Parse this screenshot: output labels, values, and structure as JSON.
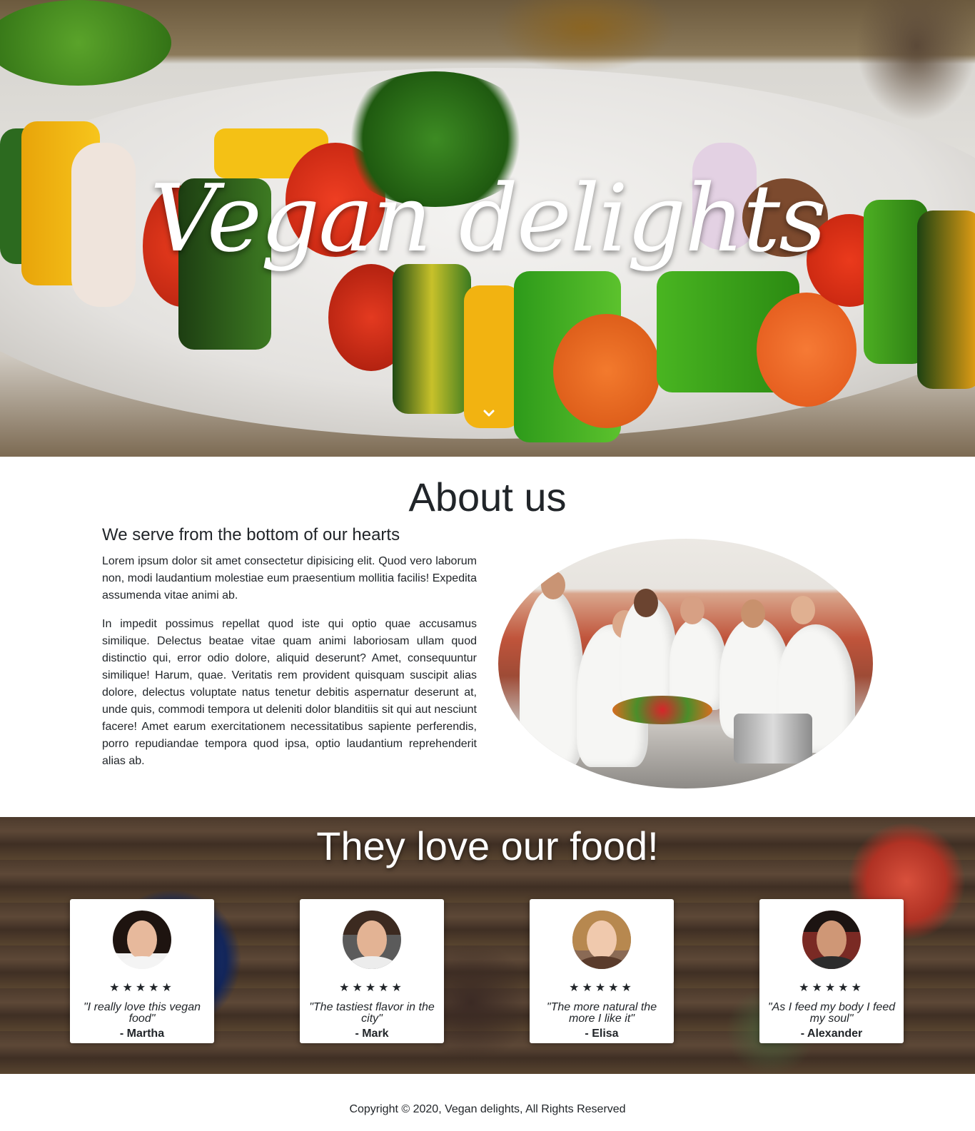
{
  "hero": {
    "title": "Vegan delights",
    "scroll_icon": "chevron-down-icon"
  },
  "about": {
    "heading": "About us",
    "subheading": "We serve from the bottom of our hearts",
    "paragraphs": [
      "Lorem ipsum dolor sit amet consectetur dipisicing elit. Quod vero laborum non, modi laudantium molestiae eum praesentium mollitia facilis! Expedita assumenda vitae animi ab.",
      "In impedit possimus repellat quod iste qui optio quae accusamus similique. Delectus beatae vitae quam animi laboriosam ullam quod distinctio qui, error odio dolore, aliquid deserunt? Amet, consequuntur similique! Harum, quae. Veritatis rem provident quisquam suscipit alias dolore, delectus voluptate natus tenetur debitis aspernatur deserunt at, unde quis, commodi tempora ut deleniti dolor blanditiis sit qui aut nesciunt facere! Amet earum exercitationem necessitatibus sapiente perferendis, porro repudiandae tempora quod ipsa, optio laudantium reprehenderit alias ab."
    ]
  },
  "testimonials": {
    "heading": "They love our food!",
    "items": [
      {
        "stars": "★★★★★",
        "rating": 5,
        "quote": "\"I really love this vegan food\"",
        "author": "- Martha"
      },
      {
        "stars": "★★★★★",
        "rating": 5,
        "quote": "\"The tastiest flavor in the city\"",
        "author": "- Mark"
      },
      {
        "stars": "★★★★★",
        "rating": 5,
        "quote": "\"The more natural the more I like it\"",
        "author": "- Elisa"
      },
      {
        "stars": "★★★★★",
        "rating": 5,
        "quote": "\"As I feed my body I feed my soul\"",
        "author": "- Alexander"
      }
    ]
  },
  "footer": {
    "copyright": "Copyright © 2020, Vegan delights, All Rights Reserved"
  }
}
